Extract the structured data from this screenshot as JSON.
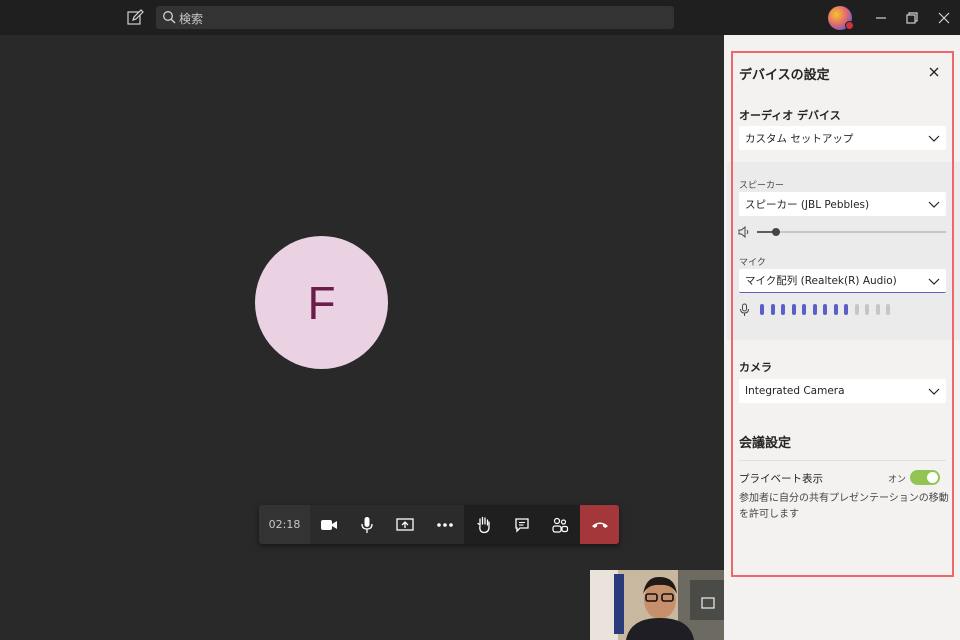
{
  "search": {
    "placeholder": "検索"
  },
  "call": {
    "participant_initial": "F",
    "timer": "02:18",
    "buttons": [
      "camera",
      "microphone",
      "share-screen",
      "more",
      "raise-hand",
      "chat",
      "participants",
      "hang-up"
    ]
  },
  "device_panel": {
    "title": "デバイスの設定",
    "audio_device_label": "オーディオ デバイス",
    "audio_device_value": "カスタム セットアップ",
    "speaker_label": "スピーカー",
    "speaker_value": "スピーカー (JBL Pebbles)",
    "speaker_volume": 0.1,
    "mic_label": "マイク",
    "mic_value": "マイク配列 (Realtek(R) Audio)",
    "mic_level_active": 9,
    "mic_level_total": 13,
    "camera_label": "カメラ",
    "camera_value": "Integrated Camera",
    "meeting_settings_title": "会議設定",
    "private_view_label": "プライベート表示",
    "private_view_state": "オン",
    "private_view_on": true,
    "private_view_description": "参加者に自分の共有プレゼンテーションの移動を許可します"
  },
  "colors": {
    "accent": "#5b5fc7",
    "hangup": "#a4373a",
    "toggle_on": "#92c353",
    "highlight_outline": "#f0676b"
  }
}
